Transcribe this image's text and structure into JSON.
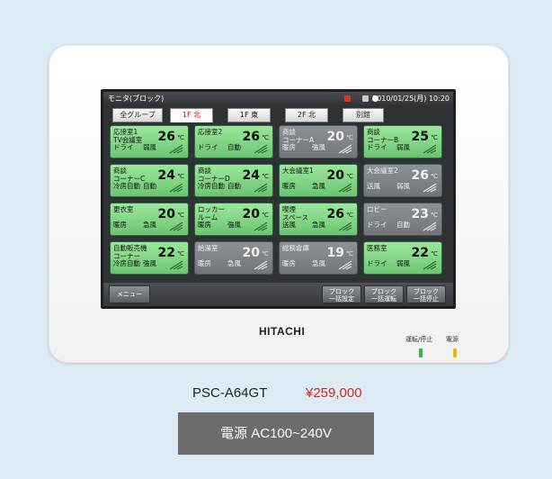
{
  "screen": {
    "title": "モニタ(ブロック)",
    "datetime": "2010/01/25(月) 10:20",
    "tabs": [
      "全グループ",
      "1F 北",
      "1F 東",
      "2F 北",
      "別館"
    ],
    "active_tab": "1F 北",
    "temp_unit": "℃",
    "units": [
      {
        "name": "応接室1\nTV会議室",
        "temp": "26",
        "mode": "ドライ",
        "fan": "弱風",
        "state": "on"
      },
      {
        "name": "応接室2",
        "temp": "26",
        "mode": "ドライ",
        "fan": "自動",
        "state": "on"
      },
      {
        "name": "商談\nコーナーA",
        "temp": "20",
        "mode": "暖房",
        "fan": "強風",
        "state": "off"
      },
      {
        "name": "商談\nコーナーB",
        "temp": "25",
        "mode": "ドライ",
        "fan": "弱風",
        "state": "on"
      },
      {
        "name": "商談\nコーナーC",
        "temp": "24",
        "mode": "冷房自動",
        "fan": "自動",
        "state": "on"
      },
      {
        "name": "商談\nコーナーD",
        "temp": "24",
        "mode": "冷房自動",
        "fan": "自動",
        "state": "on"
      },
      {
        "name": "大会議室1",
        "temp": "20",
        "mode": "暖房",
        "fan": "急風",
        "state": "on"
      },
      {
        "name": "大会議室2",
        "temp": "26",
        "mode": "送風",
        "fan": "弱風",
        "state": "off"
      },
      {
        "name": "更衣室",
        "temp": "20",
        "mode": "暖房",
        "fan": "急風",
        "state": "on"
      },
      {
        "name": "ロッカー\nルーム",
        "temp": "20",
        "mode": "暖房",
        "fan": "強風",
        "state": "on"
      },
      {
        "name": "喫煙\nスペース",
        "temp": "26",
        "mode": "送風",
        "fan": "急風",
        "state": "on"
      },
      {
        "name": "ロビー",
        "temp": "23",
        "mode": "ドライ",
        "fan": "自動",
        "state": "off"
      },
      {
        "name": "自動販売機\nコーナー",
        "temp": "22",
        "mode": "冷房自動",
        "fan": "強風",
        "state": "on"
      },
      {
        "name": "給湯室",
        "temp": "20",
        "mode": "暖房",
        "fan": "急風",
        "state": "off"
      },
      {
        "name": "総務倉庫",
        "temp": "19",
        "mode": "暖房",
        "fan": "急風",
        "state": "off"
      },
      {
        "name": "医務室",
        "temp": "22",
        "mode": "ドライ",
        "fan": "弱風",
        "state": "on"
      }
    ],
    "menu_label": "メニュー",
    "block_buttons": [
      "ブロック\n一括設定",
      "ブロック\n一括運転",
      "ブロック\n一括停止"
    ]
  },
  "device": {
    "brand": "HITACHI",
    "run_stop_label": "運転/停止",
    "power_label": "電源",
    "run_led_color": "#2db84a",
    "power_led_color": "#f5b400"
  },
  "product": {
    "model": "PSC-A64GT",
    "price": "¥259,000",
    "spec": "電源 AC100~240V"
  },
  "colors": {
    "tile_on": "#8ed98f",
    "tile_off": "#7b8085",
    "price_red": "#d8261f",
    "background": "#ddebf5"
  }
}
